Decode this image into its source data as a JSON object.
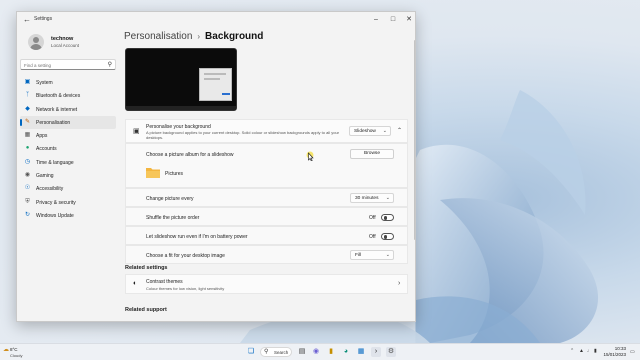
{
  "window": {
    "app_title": "Settings",
    "back_icon": "back-arrow-icon",
    "controls": [
      "minimize-icon",
      "maximize-icon",
      "close-icon"
    ]
  },
  "profile": {
    "name": "technow",
    "account_type": "Local Account"
  },
  "search": {
    "placeholder": "Find a setting",
    "icon": "search-icon"
  },
  "sidebar": {
    "items": [
      {
        "label": "System",
        "icon": "monitor-icon",
        "color": "#0067c0"
      },
      {
        "label": "Bluetooth & devices",
        "icon": "bluetooth-icon",
        "color": "#0067c0"
      },
      {
        "label": "Network & internet",
        "icon": "wifi-icon",
        "color": "#0067c0"
      },
      {
        "label": "Personalisation",
        "icon": "brush-icon",
        "color": "#c05c00",
        "selected": true
      },
      {
        "label": "Apps",
        "icon": "apps-icon",
        "color": "#555555"
      },
      {
        "label": "Accounts",
        "icon": "person-icon",
        "color": "#1aa36f"
      },
      {
        "label": "Time & language",
        "icon": "globe-clock-icon",
        "color": "#0067c0"
      },
      {
        "label": "Gaming",
        "icon": "controller-icon",
        "color": "#555555"
      },
      {
        "label": "Accessibility",
        "icon": "accessibility-icon",
        "color": "#0067c0"
      },
      {
        "label": "Privacy & security",
        "icon": "shield-icon",
        "color": "#555555"
      },
      {
        "label": "Windows Update",
        "icon": "update-icon",
        "color": "#0067c0"
      }
    ]
  },
  "header": {
    "parent": "Personalisation",
    "current": "Background"
  },
  "background": {
    "title": "Personalise your background",
    "description": "A picture background applies to your current desktop. Solid colour or slideshow backgrounds apply to all your desktops.",
    "type_value": "Slideshow",
    "album_label": "Choose a picture album for a slideshow",
    "browse_label": "Browse",
    "folder_name": "Pictures",
    "change_every_label": "Change picture every",
    "change_every_value": "30 minutes",
    "shuffle_label": "Shuffle the picture order",
    "shuffle_state": "Off",
    "battery_label": "Let slideshow run even if I'm on battery power",
    "battery_state": "Off",
    "fit_label": "Choose a fit for your desktop image",
    "fit_value": "Fill"
  },
  "related_settings": {
    "title": "Related settings",
    "contrast_title": "Contrast themes",
    "contrast_desc": "Colour themes for low vision, light sensitivity"
  },
  "related_support": {
    "title": "Related support"
  },
  "taskbar": {
    "weather_temp": "8°C",
    "weather_desc": "Cloudy",
    "search_label": "Search",
    "time": "10:33",
    "date": "15/01/2023",
    "accent": "#0067c0"
  }
}
